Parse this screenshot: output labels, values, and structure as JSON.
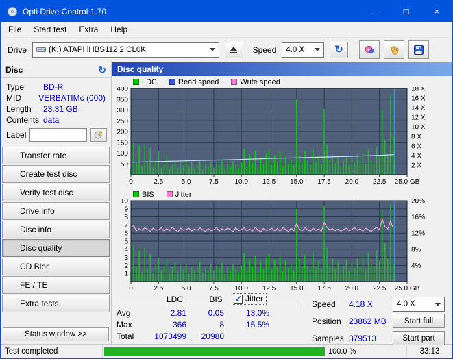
{
  "window": {
    "title": "Opti Drive Control 1.70",
    "controls": {
      "minimize": "—",
      "maximize": "□",
      "close": "×"
    }
  },
  "colors": {
    "titlebar": "#0154dd",
    "value_text": "#0000d4",
    "progress_green": "#22b322",
    "chart_background": "#50607a"
  },
  "icons": {
    "refresh": "↻"
  },
  "menu": {
    "items": [
      "File",
      "Start test",
      "Extra",
      "Help"
    ]
  },
  "toolbar": {
    "drive_label": "Drive",
    "drive_value": "(K:)   ATAPI iHBS112  2 CL0K",
    "speed_label": "Speed",
    "speed_value": "4.0 X"
  },
  "sidebar": {
    "disc_header": "Disc",
    "info": [
      {
        "label": "Type",
        "value": "BD-R"
      },
      {
        "label": "MID",
        "value": "VERBATIMc (000)"
      },
      {
        "label": "Length",
        "value": "23.31 GB"
      },
      {
        "label": "Contents",
        "value": "data"
      }
    ],
    "label_field": {
      "label": "Label",
      "value": ""
    },
    "buttons": [
      {
        "label": "Transfer rate"
      },
      {
        "label": "Create test disc"
      },
      {
        "label": "Verify test disc"
      },
      {
        "label": "Drive info"
      },
      {
        "label": "Disc info"
      },
      {
        "label": "Disc quality",
        "active": true
      },
      {
        "label": "CD Bler"
      },
      {
        "label": "FE / TE"
      },
      {
        "label": "Extra tests"
      }
    ],
    "status_window_button": "Status window >>"
  },
  "main": {
    "header": "Disc quality"
  },
  "chart_data": [
    {
      "type": "bar",
      "name": "LDC and read speed vs disc position",
      "legend": [
        {
          "label": "LDC",
          "color": "#00c800"
        },
        {
          "label": "Read speed",
          "color": "#3b52dc"
        },
        {
          "label": "Write speed",
          "color": "#f080d0"
        }
      ],
      "bg": "#50607a",
      "grid": "#2b3548",
      "border": "#141d2b",
      "x_range": [
        0,
        25
      ],
      "x_ticks": [
        {
          "v": 0,
          "label": "0"
        },
        {
          "v": 2.5,
          "label": "2.5"
        },
        {
          "v": 5,
          "label": "5.0"
        },
        {
          "v": 7.5,
          "label": "7.5"
        },
        {
          "v": 10,
          "label": "10.0"
        },
        {
          "v": 12.5,
          "label": "12.5"
        },
        {
          "v": 15,
          "label": "15.0"
        },
        {
          "v": 17.5,
          "label": "17.5"
        },
        {
          "v": 20,
          "label": "20.0"
        },
        {
          "v": 22.5,
          "label": "22.5"
        },
        {
          "v": 25,
          "label": "25.0 GB"
        }
      ],
      "left_axis": {
        "range": [
          0,
          400
        ],
        "ticks": [
          {
            "v": 400,
            "label": "400"
          },
          {
            "v": 350,
            "label": "350"
          },
          {
            "v": 300,
            "label": "300"
          },
          {
            "v": 250,
            "label": "250"
          },
          {
            "v": 200,
            "label": "200"
          },
          {
            "v": 150,
            "label": "150"
          },
          {
            "v": 100,
            "label": "100"
          },
          {
            "v": 50,
            "label": "50"
          }
        ]
      },
      "right_axis": {
        "range": [
          0,
          18
        ],
        "ticks": [
          {
            "v": 18,
            "label": "18 X"
          },
          {
            "v": 16,
            "label": "16 X"
          },
          {
            "v": 14,
            "label": "14 X"
          },
          {
            "v": 12,
            "label": "12 X"
          },
          {
            "v": 10,
            "label": "10 X"
          },
          {
            "v": 8,
            "label": "8 X"
          },
          {
            "v": 6,
            "label": "6 X"
          },
          {
            "v": 4,
            "label": "4 X"
          },
          {
            "v": 2,
            "label": "2 X"
          }
        ]
      },
      "cursor_gb": 23.86,
      "cursor_color": "#2a9dff",
      "series": [
        {
          "name": "LDC",
          "kind": "bars",
          "axis": "left",
          "color": "#00cc00",
          "x_start": 0,
          "x_step": 0.25,
          "values": [
            25,
            150,
            60,
            135,
            40,
            145,
            55,
            125,
            35,
            60,
            110,
            30,
            50,
            95,
            28,
            45,
            70,
            32,
            55,
            40,
            65,
            35,
            58,
            30,
            48,
            62,
            28,
            52,
            38,
            60,
            33,
            55,
            42,
            68,
            30,
            50,
            36,
            62,
            45,
            28,
            58,
            120,
            40,
            95,
            55,
            110,
            35,
            80,
            48,
            100,
            115,
            45,
            90,
            60,
            105,
            38,
            85,
            50,
            70,
            42,
            350,
            90,
            55,
            110,
            65,
            45,
            120,
            58,
            85,
            48,
            305,
            140,
            70,
            95,
            52,
            80,
            40,
            65,
            88,
            45,
            75,
            55,
            95,
            60,
            110,
            48,
            120,
            70,
            58,
            130,
            85,
            300,
            160,
            95,
            370,
            180,
            0,
            0,
            0,
            0,
            0
          ]
        },
        {
          "name": "Read speed",
          "kind": "line",
          "axis": "right",
          "color": "#bfe4ff",
          "x": [
            0,
            2.5,
            5,
            7.5,
            10,
            12.5,
            15,
            17.5,
            20,
            22.5,
            23.86
          ],
          "values": [
            2.6,
            2.75,
            2.9,
            3.05,
            3.2,
            3.4,
            3.55,
            3.7,
            3.85,
            4.05,
            4.18
          ]
        }
      ]
    },
    {
      "type": "bar",
      "name": "BIS and jitter vs disc position",
      "legend": [
        {
          "label": "BIS",
          "color": "#00c800"
        },
        {
          "label": "Jitter",
          "color": "#f080d0"
        }
      ],
      "bg": "#50607a",
      "grid": "#2b3548",
      "border": "#141d2b",
      "x_range": [
        0,
        25
      ],
      "x_ticks": [
        {
          "v": 0,
          "label": "0"
        },
        {
          "v": 2.5,
          "label": "2.5"
        },
        {
          "v": 5,
          "label": "5.0"
        },
        {
          "v": 7.5,
          "label": "7.5"
        },
        {
          "v": 10,
          "label": "10.0"
        },
        {
          "v": 12.5,
          "label": "12.5"
        },
        {
          "v": 15,
          "label": "15.0"
        },
        {
          "v": 17.5,
          "label": "17.5"
        },
        {
          "v": 20,
          "label": "20.0"
        },
        {
          "v": 22.5,
          "label": "22.5"
        },
        {
          "v": 25,
          "label": "25.0 GB"
        }
      ],
      "left_axis": {
        "range": [
          0,
          10
        ],
        "ticks": [
          {
            "v": 10,
            "label": "10"
          },
          {
            "v": 9,
            "label": "9"
          },
          {
            "v": 8,
            "label": "8"
          },
          {
            "v": 7,
            "label": "7"
          },
          {
            "v": 6,
            "label": "6"
          },
          {
            "v": 5,
            "label": "5"
          },
          {
            "v": 4,
            "label": "4"
          },
          {
            "v": 3,
            "label": "3"
          },
          {
            "v": 2,
            "label": "2"
          },
          {
            "v": 1,
            "label": "1"
          }
        ]
      },
      "right_axis": {
        "range": [
          0,
          20
        ],
        "ticks": [
          {
            "v": 20,
            "label": "20%"
          },
          {
            "v": 16,
            "label": "16%"
          },
          {
            "v": 12,
            "label": "12%"
          },
          {
            "v": 8,
            "label": "8%"
          },
          {
            "v": 4,
            "label": "4%"
          }
        ]
      },
      "cursor_gb": 23.86,
      "cursor_color": "#2a9dff",
      "series": [
        {
          "name": "BIS",
          "kind": "bars",
          "axis": "left",
          "color": "#00cc00",
          "x_start": 0,
          "x_step": 0.25,
          "values": [
            1.2,
            4.5,
            1.8,
            3.8,
            1.2,
            4.2,
            1.5,
            3.5,
            1.0,
            2.2,
            3.0,
            1.4,
            2.0,
            2.8,
            1.1,
            1.8,
            2.4,
            1.2,
            2.0,
            1.5,
            2.2,
            1.0,
            1.8,
            1.3,
            2.0,
            2.5,
            1.1,
            1.7,
            1.3,
            2.1,
            1.4,
            2.0,
            1.6,
            2.3,
            1.0,
            1.8,
            1.3,
            2.1,
            1.6,
            1.1,
            2.0,
            3.5,
            1.5,
            2.8,
            1.9,
            3.2,
            1.2,
            2.5,
            1.6,
            3.0,
            3.4,
            1.5,
            2.7,
            1.9,
            3.1,
            1.3,
            2.6,
            1.7,
            2.2,
            1.4,
            9.0,
            2.8,
            1.8,
            3.3,
            2.0,
            1.5,
            3.6,
            1.8,
            2.6,
            1.5,
            9.4,
            4.2,
            2.2,
            2.9,
            1.6,
            2.5,
            1.3,
            2.0,
            2.7,
            1.4,
            2.3,
            1.7,
            2.9,
            1.8,
            3.3,
            1.5,
            3.6,
            2.1,
            1.8,
            3.9,
            2.6,
            8.8,
            4.8,
            2.9,
            9.6,
            2.2,
            0,
            0,
            0,
            0,
            0
          ]
        },
        {
          "name": "Jitter",
          "kind": "line",
          "axis": "right",
          "color": "#f4a8e4",
          "x_start": 0,
          "x_step": 0.25,
          "values": [
            13.4,
            13.8,
            12.6,
            13.1,
            12.7,
            13.3,
            12.9,
            12.4,
            13.2,
            12.7,
            12.8,
            13.3,
            12.5,
            13.1,
            12.6,
            13.4,
            12.9,
            12.3,
            13.2,
            12.7,
            12.9,
            13.2,
            12.5,
            13.0,
            12.7,
            13.3,
            12.8,
            12.4,
            13.1,
            12.6,
            12.8,
            13.4,
            12.5,
            13.1,
            12.7,
            13.2,
            12.9,
            12.4,
            13.3,
            12.6,
            12.9,
            13.3,
            12.6,
            13.0,
            12.5,
            13.4,
            12.8,
            12.3,
            13.1,
            12.7,
            12.8,
            13.2,
            12.6,
            13.1,
            12.5,
            13.3,
            12.9,
            12.4,
            13.2,
            12.6,
            14.3,
            13.0,
            12.6,
            13.3,
            12.8,
            12.5,
            13.2,
            12.7,
            13.0,
            12.5,
            14.6,
            13.4,
            12.8,
            13.1,
            12.6,
            13.0,
            12.5,
            12.9,
            13.2,
            12.6,
            12.9,
            13.3,
            12.7,
            13.1,
            12.5,
            13.2,
            12.8,
            12.4,
            13.0,
            13.4,
            12.8,
            15.5,
            13.6,
            13.0,
            14.9,
            13.2
          ]
        }
      ]
    }
  ],
  "bottom_panel": {
    "table": {
      "col_headers": [
        "LDC",
        "BIS"
      ],
      "jitter": {
        "label": "Jitter",
        "checked": true
      },
      "rows": [
        {
          "label": "Avg",
          "ldc": "2.81",
          "bis": "0.05",
          "jitter": "13.0%"
        },
        {
          "label": "Max",
          "ldc": "366",
          "bis": "8",
          "jitter": "15.5%"
        },
        {
          "label": "Total",
          "ldc": "1073499",
          "bis": "20980",
          "jitter": ""
        }
      ]
    },
    "speed": {
      "label": "Speed",
      "value": "4.18 X",
      "selector": "4.0 X"
    },
    "position": {
      "label": "Position",
      "value": "23862 MB"
    },
    "samples": {
      "label": "Samples",
      "value": "379513"
    },
    "buttons": {
      "start_full": "Start full",
      "start_part": "Start part"
    }
  },
  "statusbar": {
    "status": "Test completed",
    "progress": "100.0 %",
    "time": "33:13"
  }
}
